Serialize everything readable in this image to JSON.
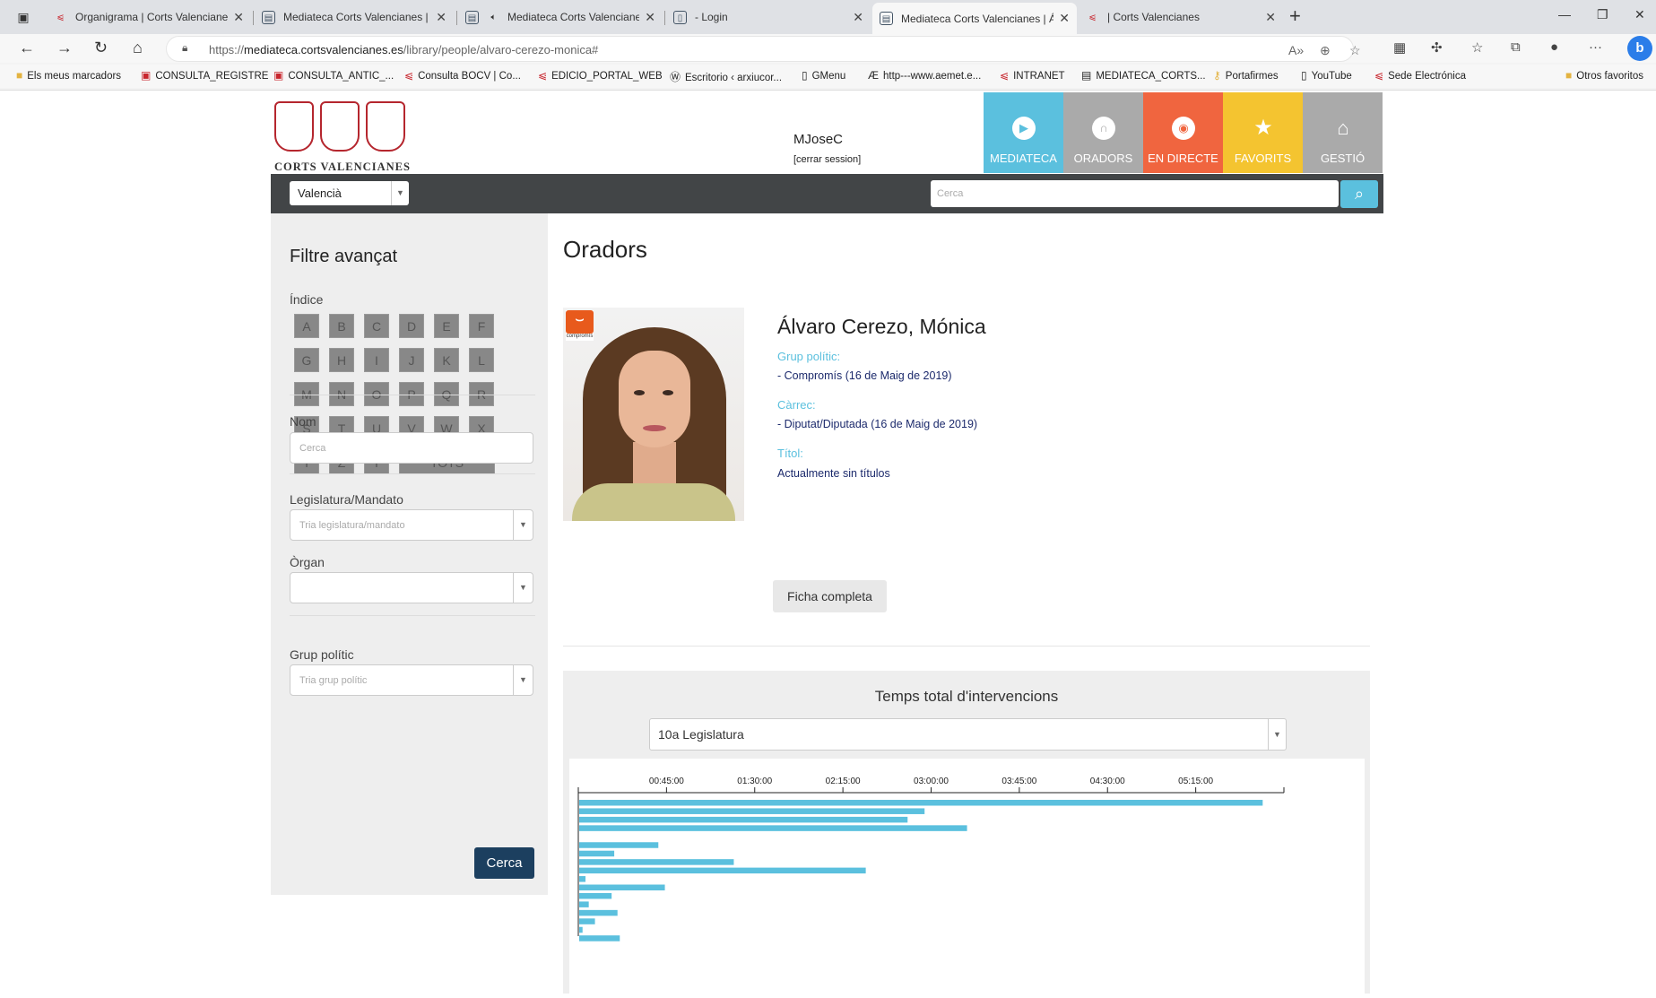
{
  "browser": {
    "tabs": [
      {
        "title": "Organigrama | Corts Valencianes",
        "icon": "cv-icon"
      },
      {
        "title": "Mediateca Corts Valencianes | Vi",
        "icon": "doc-icon"
      },
      {
        "title": "Mediateca Corts Valencianes",
        "icon": "doc-icon"
      },
      {
        "title": "- Login",
        "icon": "page-icon"
      },
      {
        "title": "Mediateca Corts Valencianes | Ál",
        "icon": "doc-icon"
      },
      {
        "title": "| Corts Valencianes",
        "icon": "cv-icon"
      }
    ],
    "url_prefix": "https://",
    "url_host": "mediateca.cortsvalencianes.es",
    "url_path": "/library/people/alvaro-cerezo-monica#",
    "bookmarks": [
      "Els meus marcadors",
      "CONSULTA_REGISTRE",
      "CONSULTA_ANTIC_...",
      "Consulta BOCV | Co...",
      "EDICIO_PORTAL_WEB",
      "Escritorio ‹ arxiucor...",
      "GMenu",
      "http---www.aemet.e...",
      "INTRANET",
      "MEDIATECA_CORTS...",
      "Portafirmes",
      "YouTube",
      "Sede Electrónica",
      "Otros favoritos"
    ]
  },
  "site": {
    "logo_caption": "CORTS VALENCIANES",
    "user": "MJoseC",
    "logout": "[cerrar session]",
    "nav": [
      {
        "label": "MEDIATECA",
        "icon": "play-icon",
        "color": "#5bc0de"
      },
      {
        "label": "ORADORS",
        "icon": "speaker-icon",
        "color": "#aaaaaa"
      },
      {
        "label": "EN DIRECTE",
        "icon": "live-icon",
        "color": "#f0653f"
      },
      {
        "label": "FAVORITS",
        "icon": "star-icon",
        "color": "#f4c430"
      },
      {
        "label": "GESTIÓ",
        "icon": "institution-icon",
        "color": "#aaaaaa"
      }
    ],
    "language": "Valencià",
    "search_placeholder": "Cerca"
  },
  "filter": {
    "title": "Filtre avançat",
    "index_label": "Índice",
    "letters": [
      "A",
      "B",
      "C",
      "D",
      "E",
      "F",
      "G",
      "H",
      "I",
      "J",
      "K",
      "L",
      "M",
      "N",
      "O",
      "P",
      "Q",
      "R",
      "S",
      "T",
      "U",
      "V",
      "W",
      "X",
      "Y",
      "Z",
      "I"
    ],
    "all_label": "TOTS",
    "name_label": "Nom",
    "name_placeholder": "Cerca",
    "legislature_label": "Legislatura/Mandato",
    "legislature_placeholder": "Tria legislatura/mandato",
    "organ_label": "Òrgan",
    "group_label": "Grup polític",
    "group_placeholder": "Tria grup polític",
    "search_button": "Cerca"
  },
  "main": {
    "title": "Oradors",
    "speaker_name": "Álvaro Cerezo, Mónica",
    "party_logo_text": "compromís",
    "group_label": "Grup polític:",
    "group_value": "- Compromís (16 de Maig de 2019)",
    "post_label": "Càrrec:",
    "post_value": "- Diputat/Diputada (16 de Maig de 2019)",
    "title_label": "Títol:",
    "title_value": "Actualmente sin títulos",
    "full_record_button": "Ficha completa"
  },
  "chart_data": {
    "type": "bar",
    "title": "Temps total d'intervencions",
    "selector": "10a Legislatura",
    "orientation": "horizontal",
    "tick_labels": [
      "00:45:00",
      "01:30:00",
      "02:15:00",
      "03:00:00",
      "03:45:00",
      "04:30:00",
      "05:15:00"
    ],
    "xlim_seconds": [
      0,
      21600
    ],
    "values_seconds": [
      20950,
      10600,
      10080,
      11900,
      0,
      2450,
      1100,
      4760,
      8800,
      220,
      2650,
      1020,
      320,
      1200,
      510,
      130,
      1270
    ],
    "bar_color": "#5bc0de"
  }
}
